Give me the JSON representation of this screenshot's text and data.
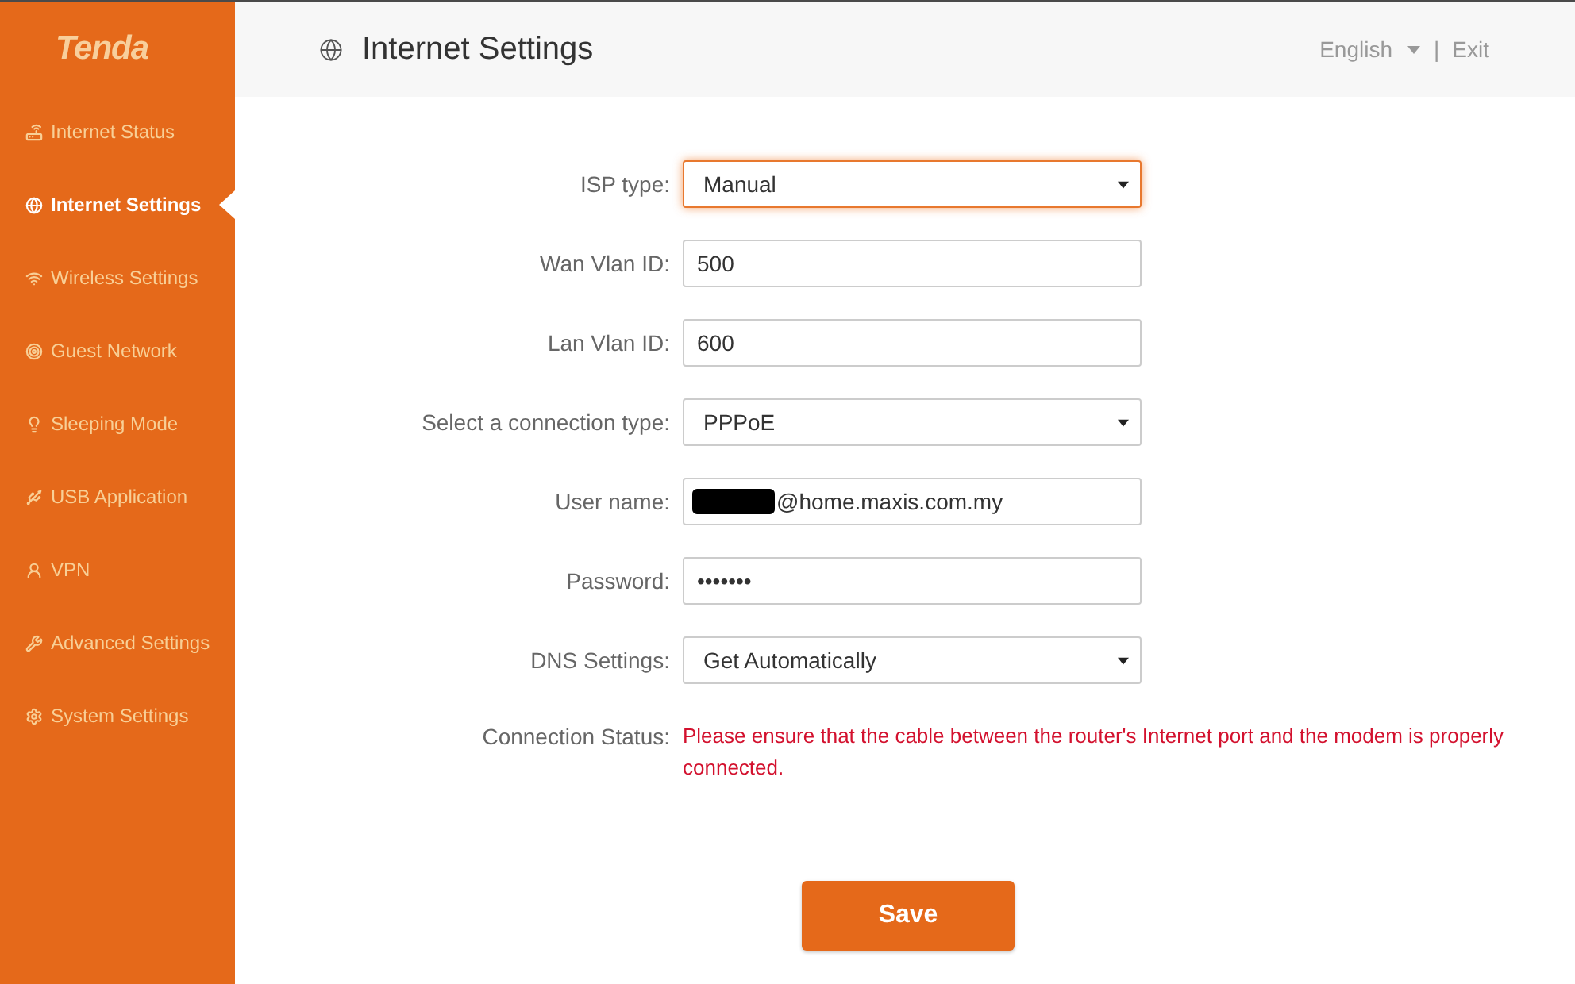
{
  "sidebar": {
    "logo": "Tenda",
    "items": [
      {
        "label": "Internet Status",
        "selected": false
      },
      {
        "label": "Internet Settings",
        "selected": true
      },
      {
        "label": "Wireless Settings",
        "selected": false
      },
      {
        "label": "Guest Network",
        "selected": false
      },
      {
        "label": "Sleeping Mode",
        "selected": false
      },
      {
        "label": "USB Application",
        "selected": false
      },
      {
        "label": "VPN",
        "selected": false
      },
      {
        "label": "Advanced Settings",
        "selected": false
      },
      {
        "label": "System Settings",
        "selected": false
      }
    ]
  },
  "header": {
    "title": "Internet Settings",
    "language": "English",
    "separator": "|",
    "exit": "Exit"
  },
  "form": {
    "fields": [
      {
        "kind": "select",
        "label": "ISP type:",
        "value": "Manual",
        "focused": true,
        "redacted": false
      },
      {
        "kind": "text",
        "label": "Wan Vlan ID:",
        "value": "500",
        "focused": false,
        "redacted": false
      },
      {
        "kind": "text",
        "label": "Lan Vlan ID:",
        "value": "600",
        "focused": false,
        "redacted": false
      },
      {
        "kind": "select",
        "label": "Select a connection type:",
        "value": "PPPoE",
        "focused": false,
        "redacted": false
      },
      {
        "kind": "text",
        "label": "User name:",
        "value": "@home.maxis.com.my",
        "focused": false,
        "redacted": true
      },
      {
        "kind": "password",
        "label": "Password:",
        "value": "•••••••",
        "focused": false,
        "redacted": false
      },
      {
        "kind": "select",
        "label": "DNS Settings:",
        "value": "Get Automatically",
        "focused": false,
        "redacted": false
      }
    ],
    "connection_status": {
      "label": "Connection Status:",
      "message": "Please ensure that the cable between the router's Internet port and the modem is properly connected."
    },
    "save_button": "Save"
  }
}
